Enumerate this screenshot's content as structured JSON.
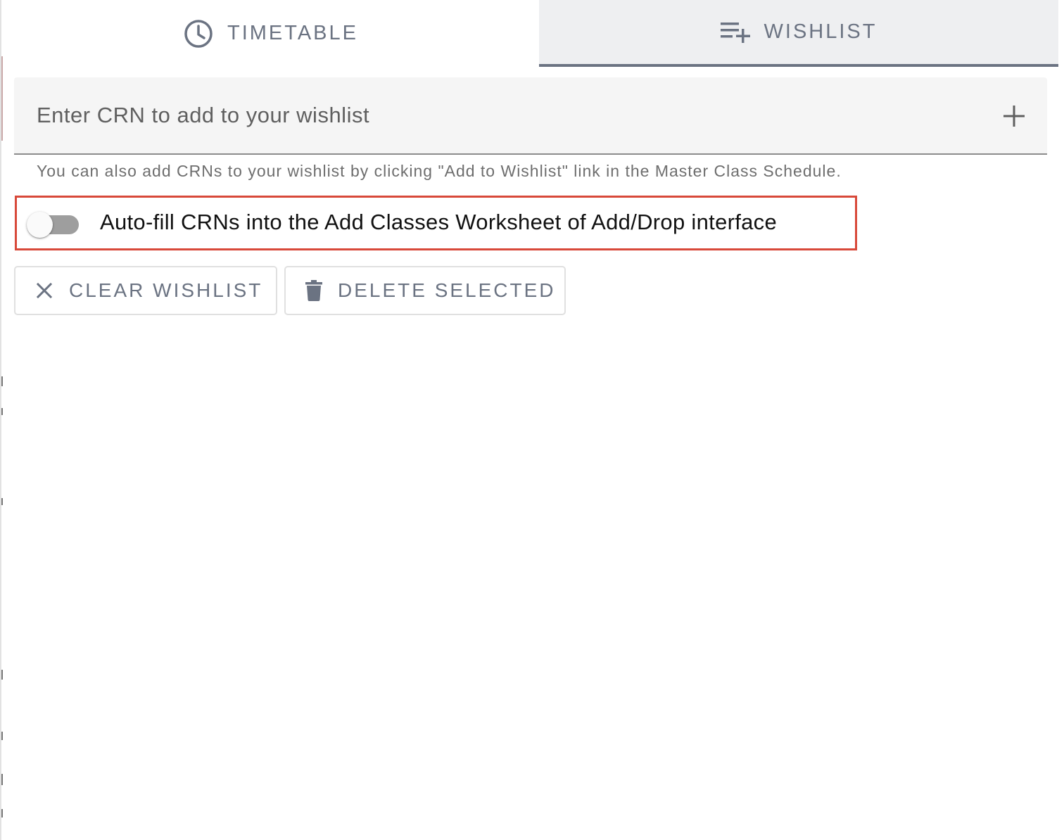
{
  "tabs": [
    {
      "label": "TIMETABLE",
      "icon": "clock-icon",
      "active": false
    },
    {
      "label": "WISHLIST",
      "icon": "playlist-add-icon",
      "active": true
    }
  ],
  "crn_input": {
    "placeholder": "Enter CRN to add to your wishlist",
    "value": "",
    "add_icon": "plus-icon"
  },
  "helper_text": "You can also add CRNs to your wishlist by clicking \"Add to Wishlist\" link in the Master Class Schedule.",
  "autofill": {
    "label": "Auto-fill CRNs into the Add Classes Worksheet of Add/Drop interface",
    "enabled": false,
    "highlight_color": "#d8493a"
  },
  "actions": {
    "clear": {
      "label": "CLEAR WISHLIST",
      "icon": "close-icon"
    },
    "delete": {
      "label": "DELETE SELECTED",
      "icon": "trash-icon"
    }
  },
  "colors": {
    "tab_text": "#6b7382",
    "active_tab_bg": "#eeeff1",
    "input_bg": "#f5f5f5"
  }
}
